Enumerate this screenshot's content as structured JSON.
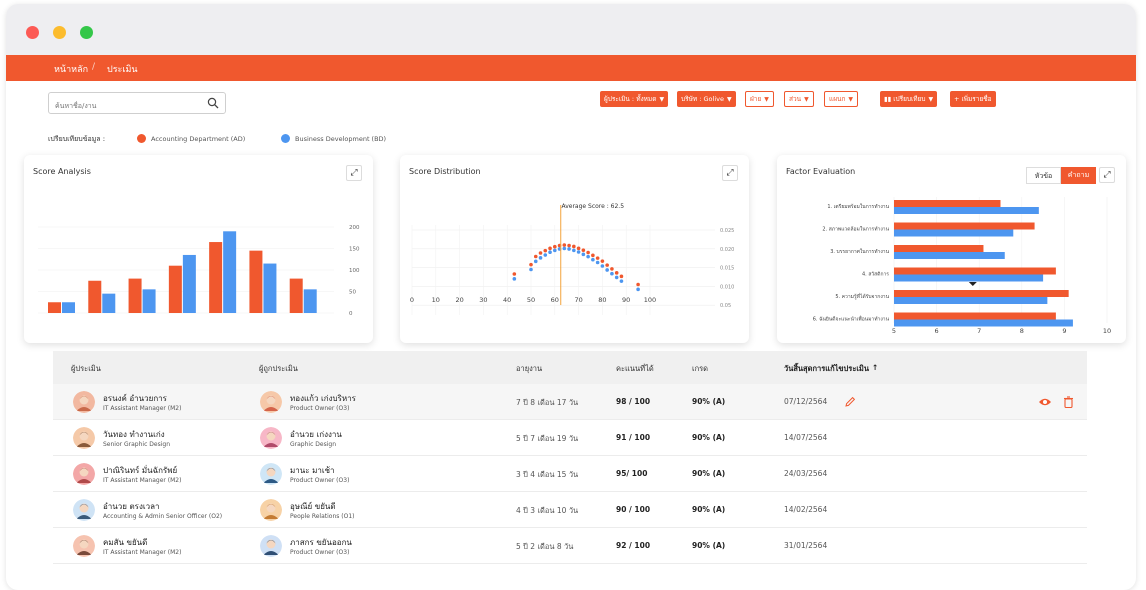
{
  "window": {
    "controls": [
      "close",
      "minimize",
      "maximize"
    ]
  },
  "nav": {
    "breadcrumb": [
      "หน้าหลัก",
      "ประเมิน"
    ],
    "separator": "/"
  },
  "search": {
    "placeholder": "ค้นหาชื่อ/งาน"
  },
  "filters": [
    {
      "label": "ผู้ประเมิน : ทั้งหมด",
      "style": "solid"
    },
    {
      "label": "บริษัท : Golive",
      "style": "solid"
    },
    {
      "label": "ฝ่าย",
      "style": "outline"
    },
    {
      "label": "ส่วน",
      "style": "outline"
    },
    {
      "label": "แผนก",
      "style": "outline"
    }
  ],
  "actions": {
    "compare": "เปรียบเทียบ",
    "add": "เพิ่มรายชื่อ"
  },
  "compare_legend": {
    "label": "เปรียบเทียบข้อมูล :",
    "items": [
      {
        "name": "Accounting Department (AD)",
        "color": "#f0582e"
      },
      {
        "name": "Business Development (BD)",
        "color": "#4d96f0"
      }
    ]
  },
  "cards": {
    "score_analysis": "Score Analysis",
    "score_distribution": "Score Distribution",
    "factor_evaluation": "Factor Evaluation",
    "toggle": [
      "หัวข้อ",
      "คำถาม"
    ]
  },
  "chart_data": [
    {
      "type": "bar",
      "title": "Score Analysis",
      "categories": [
        "",
        "",
        "",
        "",
        "",
        "",
        ""
      ],
      "series": [
        {
          "values": [
            25,
            75,
            80,
            110,
            165,
            145,
            80
          ]
        },
        {
          "values": [
            25,
            45,
            55,
            135,
            190,
            115,
            55
          ]
        }
      ],
      "y_ticks": [
        0,
        50,
        100,
        150,
        200
      ],
      "ylim": [
        0,
        200
      ],
      "colors": [
        "#f0582e",
        "#4d96f0"
      ]
    },
    {
      "type": "scatter",
      "title": "Score Distribution",
      "annotation": "Average Score : 62.5",
      "average": 62.5,
      "x_ticks": [
        0,
        10,
        20,
        30,
        40,
        50,
        60,
        70,
        80,
        90,
        100
      ],
      "y_ticks": [
        "0.025",
        "0.020",
        "0.015",
        "0.010",
        "0.05"
      ],
      "xlim": [
        0,
        100
      ],
      "ylim": [
        0,
        0.03
      ],
      "series": [
        {
          "x": [
            43,
            50,
            52,
            54,
            56,
            58,
            60,
            62,
            64,
            66,
            68,
            70,
            72,
            74,
            76,
            78,
            80,
            82,
            84,
            86,
            88,
            95
          ],
          "y": [
            0.009,
            0.013,
            0.0165,
            0.018,
            0.019,
            0.02,
            0.0207,
            0.0212,
            0.0214,
            0.0212,
            0.0208,
            0.02,
            0.0192,
            0.0182,
            0.017,
            0.0158,
            0.0145,
            0.0128,
            0.0112,
            0.0095,
            0.008,
            0.0045
          ]
        },
        {
          "x": [
            43,
            50,
            52,
            54,
            56,
            58,
            60,
            62,
            64,
            66,
            68,
            70,
            72,
            74,
            76,
            78,
            80,
            82,
            84,
            86,
            88,
            95
          ],
          "y": [
            0.008,
            0.012,
            0.0155,
            0.017,
            0.0182,
            0.0194,
            0.0202,
            0.0208,
            0.021,
            0.0208,
            0.0202,
            0.0195,
            0.0185,
            0.0175,
            0.0162,
            0.015,
            0.0135,
            0.0118,
            0.0102,
            0.0086,
            0.007,
            0.0035
          ]
        }
      ],
      "colors": [
        "#f0582e",
        "#4d96f0"
      ]
    },
    {
      "type": "bar",
      "orientation": "horizontal",
      "title": "Factor Evaluation",
      "categories": [
        "1. เตรียมพร้อมในการทำงาน",
        "2. สภาพแวดล้อมในการทำงาน",
        "3. บรรยากาศในการทำงาน",
        "4. สวัสดิการ",
        "5. ความรู้ที่ได้รับจากงาน",
        "6. ฉันยินดีจะแนะนำเพื่อนมาทำงาน"
      ],
      "series": [
        {
          "values": [
            7.5,
            8.3,
            7.1,
            8.8,
            9.1,
            8.8
          ]
        },
        {
          "values": [
            8.4,
            7.8,
            7.6,
            8.5,
            8.6,
            9.2
          ]
        }
      ],
      "x_ticks": [
        5,
        6,
        7,
        8,
        9,
        10
      ],
      "xlim": [
        5,
        10
      ],
      "marker_value": 6.85,
      "colors": [
        "#f0582e",
        "#4d96f0"
      ]
    }
  ],
  "table": {
    "headers": [
      "ผู้ประเมิน",
      "ผู้ถูกประเมิน",
      "อายุงาน",
      "คะแนนที่ได้",
      "เกรด",
      "วันสิ้นสุดการแก้ไขประเมิน"
    ],
    "sort_indicator": "↑",
    "rows": [
      {
        "evaluator": "อรนงค์ อำนวยการ",
        "evaluator_role": "IT Assistant Manager (M2)",
        "evaluatee": "ทองแก้ว เก่งบริหาร",
        "evaluatee_role": "Product Owner (O3)",
        "tenure": "7 ปี 8 เดือน 17 วัน",
        "score": "98 / 100",
        "grade": "90% (A)",
        "due": "07/12/2564"
      },
      {
        "evaluator": "วันทอง ทำงานเก่ง",
        "evaluator_role": "Senior Graphic Design",
        "evaluatee": "อำนวย เก่งงาน",
        "evaluatee_role": "Graphic Design",
        "tenure": "5 ปี 7 เดือน 19 วัน",
        "score": "91 / 100",
        "grade": "90% (A)",
        "due": "14/07/2564"
      },
      {
        "evaluator": "ปาณิรินทร์ มั่นฉักรัพย์",
        "evaluator_role": "IT Assistant Manager (M2)",
        "evaluatee": "มานะ มาเช้า",
        "evaluatee_role": "Product Owner (O3)",
        "tenure": "3 ปี 4 เดือน 15 วัน",
        "score": "95/ 100",
        "grade": "90% (A)",
        "due": "24/03/2564"
      },
      {
        "evaluator": "อำนวย ตรงเวลา",
        "evaluator_role": "Accounting & Admin Senior Officer (O2)",
        "evaluatee": "อุษณีย์ ขยันดี",
        "evaluatee_role": "People Relations (O1)",
        "tenure": "4 ปี 3 เดือน 10 วัน",
        "score": "90 / 100",
        "grade": "90% (A)",
        "due": "14/02/2564"
      },
      {
        "evaluator": "คมสัน ขยันดี",
        "evaluator_role": "IT Assistant Manager (M2)",
        "evaluatee": "ภาสกร ขยันออกน",
        "evaluatee_role": "Product Owner (O3)",
        "tenure": "5   ปี 2 เดือน 8 วัน",
        "score": "92 / 100",
        "grade": "90% (A)",
        "due": "31/01/2564"
      }
    ]
  }
}
